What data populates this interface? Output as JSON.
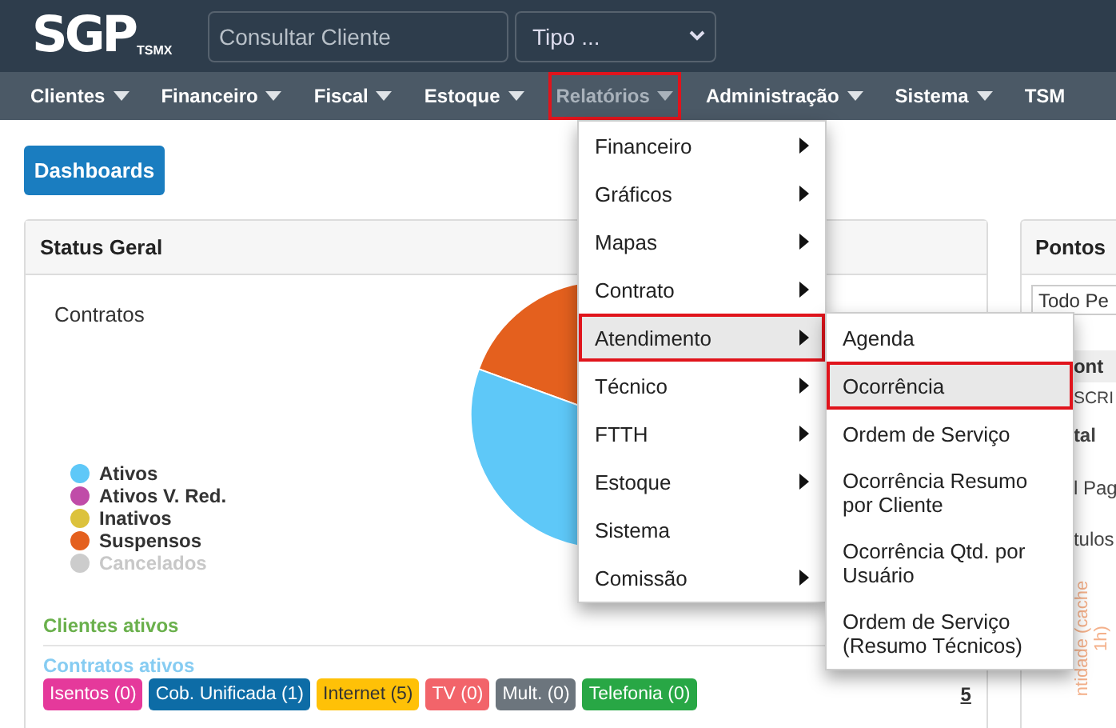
{
  "header": {
    "logo": {
      "main": "SGP",
      "sub": "TSMX"
    },
    "search": {
      "placeholder": "Consultar Cliente"
    },
    "type_select": {
      "value": "Tipo ..."
    }
  },
  "nav": [
    {
      "label": "Clientes",
      "selected": false,
      "outlined": false
    },
    {
      "label": "Financeiro",
      "selected": false,
      "outlined": false
    },
    {
      "label": "Fiscal",
      "selected": false,
      "outlined": false
    },
    {
      "label": "Estoque",
      "selected": false,
      "outlined": false
    },
    {
      "label": "Relatórios",
      "selected": true,
      "outlined": true
    },
    {
      "label": "Administração",
      "selected": false,
      "outlined": false
    },
    {
      "label": "Sistema",
      "selected": false,
      "outlined": false
    },
    {
      "label": "TSM",
      "selected": false,
      "outlined": false
    }
  ],
  "dashboards_button": "Dashboards",
  "status_panel": {
    "title": "Status Geral",
    "chart_title": "Contratos",
    "legend": [
      {
        "label": "Ativos",
        "color": "#5ec8f8",
        "hidden": false
      },
      {
        "label": "Ativos V. Red.",
        "color": "#c04ca8",
        "hidden": false
      },
      {
        "label": "Inativos",
        "color": "#dcc23c",
        "hidden": false
      },
      {
        "label": "Suspensos",
        "color": "#e4601e",
        "hidden": false
      },
      {
        "label": "Cancelados",
        "color": "#cccccc",
        "hidden": true
      }
    ],
    "clientes_ativos": "Clientes ativos",
    "contratos_ativos": "Contratos ativos",
    "tags": [
      {
        "label": "Isentos (0)",
        "color": "#e5399b"
      },
      {
        "label": "Cob. Unificada (1)",
        "color": "#0d6ca6"
      },
      {
        "label": "Internet (5)",
        "color": "#ffc107"
      },
      {
        "label": "TV (0)",
        "color": "#f2646a"
      },
      {
        "label": "Mult. (0)",
        "color": "#6c757d"
      },
      {
        "label": "Telefonia (0)",
        "color": "#28a745"
      }
    ],
    "total_link": "5"
  },
  "right_panel": {
    "title": "Pontos",
    "select_value": "Todo Pe",
    "table_header": "ont",
    "row_text": "SCRI",
    "total": "tal",
    "line_1": "l Pag",
    "line_2": "tulos",
    "rotated_label": "ntidade (cache 1h)"
  },
  "menu": [
    {
      "label": "Financeiro",
      "has_submenu": true,
      "selected": false,
      "outlined": false
    },
    {
      "label": "Gráficos",
      "has_submenu": true,
      "selected": false,
      "outlined": false
    },
    {
      "label": "Mapas",
      "has_submenu": true,
      "selected": false,
      "outlined": false
    },
    {
      "label": "Contrato",
      "has_submenu": true,
      "selected": false,
      "outlined": false
    },
    {
      "label": "Atendimento",
      "has_submenu": true,
      "selected": true,
      "outlined": true
    },
    {
      "label": "Técnico",
      "has_submenu": true,
      "selected": false,
      "outlined": false
    },
    {
      "label": "FTTH",
      "has_submenu": true,
      "selected": false,
      "outlined": false
    },
    {
      "label": "Estoque",
      "has_submenu": true,
      "selected": false,
      "outlined": false
    },
    {
      "label": "Sistema",
      "has_submenu": false,
      "selected": false,
      "outlined": false
    },
    {
      "label": "Comissão",
      "has_submenu": true,
      "selected": false,
      "outlined": false
    }
  ],
  "submenu": [
    {
      "label": "Agenda",
      "selected": false,
      "outlined": false
    },
    {
      "label": "Ocorrência",
      "selected": true,
      "outlined": true
    },
    {
      "label": "Ordem de Serviço",
      "selected": false,
      "outlined": false
    },
    {
      "label": "Ocorrência Resumo por Cliente",
      "selected": false,
      "outlined": false
    },
    {
      "label": "Ocorrência Qtd. por Usuário",
      "selected": false,
      "outlined": false
    },
    {
      "label": "Ordem de Serviço (Resumo Técnicos)",
      "selected": false,
      "outlined": false
    }
  ]
}
